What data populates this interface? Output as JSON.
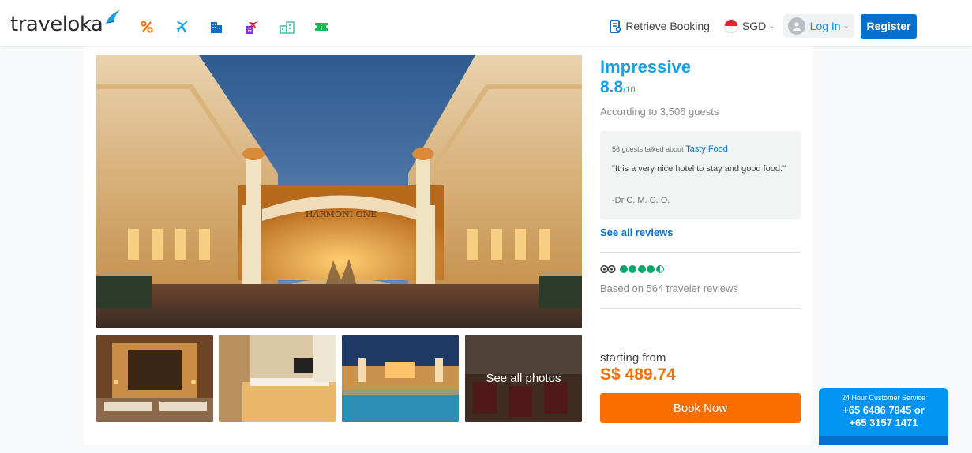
{
  "brand": {
    "logo_text": "traveloka"
  },
  "product_nav": {
    "items": [
      {
        "name": "deals",
        "icon": "percent-icon",
        "color": "#f96d01"
      },
      {
        "name": "flights",
        "icon": "airplane-icon",
        "color": "#1ba0e2"
      },
      {
        "name": "hotels",
        "icon": "hotel-icon",
        "color": "#0770cd"
      },
      {
        "name": "flight-hotel",
        "icon": "flight-hotel-icon",
        "color": "#8a2be2"
      },
      {
        "name": "villas",
        "icon": "villa-icon",
        "color": "#4cc4b3"
      },
      {
        "name": "tickets",
        "icon": "ticket-icon",
        "color": "#1db954"
      }
    ]
  },
  "header": {
    "retrieve_booking": "Retrieve Booking",
    "currency": "SGD",
    "login": "Log In",
    "register": "Register"
  },
  "gallery": {
    "hotel_sign": "HARMONI ONE",
    "see_all_photos": "See all photos"
  },
  "rating": {
    "word": "Impressive",
    "score": "8.8",
    "out_of": "/10",
    "count_text": "According to 3,506 guests"
  },
  "review": {
    "topic_prefix": "56 guests talked about",
    "topic": "Tasty Food",
    "quote": "\"It is a very nice hotel to stay and good food.\"",
    "author": "-Dr C. M. C. O."
  },
  "see_all_reviews": "See all reviews",
  "tripadvisor": {
    "rating": 4.5,
    "max": 5,
    "text": "Based on 564 traveler reviews"
  },
  "pricing": {
    "starting_from": "starting from",
    "price": "S$ 489.74",
    "book_now": "Book Now"
  },
  "customer_service": {
    "title": "24 Hour Customer Service",
    "phone_1": "+65 6486 7945 or",
    "phone_2": "+65 3157 1471"
  },
  "colors": {
    "brand_blue": "#0194f3",
    "accent_orange": "#f96d01",
    "rating_blue": "#1ba0e2",
    "tripadvisor_green": "#00aa6c"
  }
}
